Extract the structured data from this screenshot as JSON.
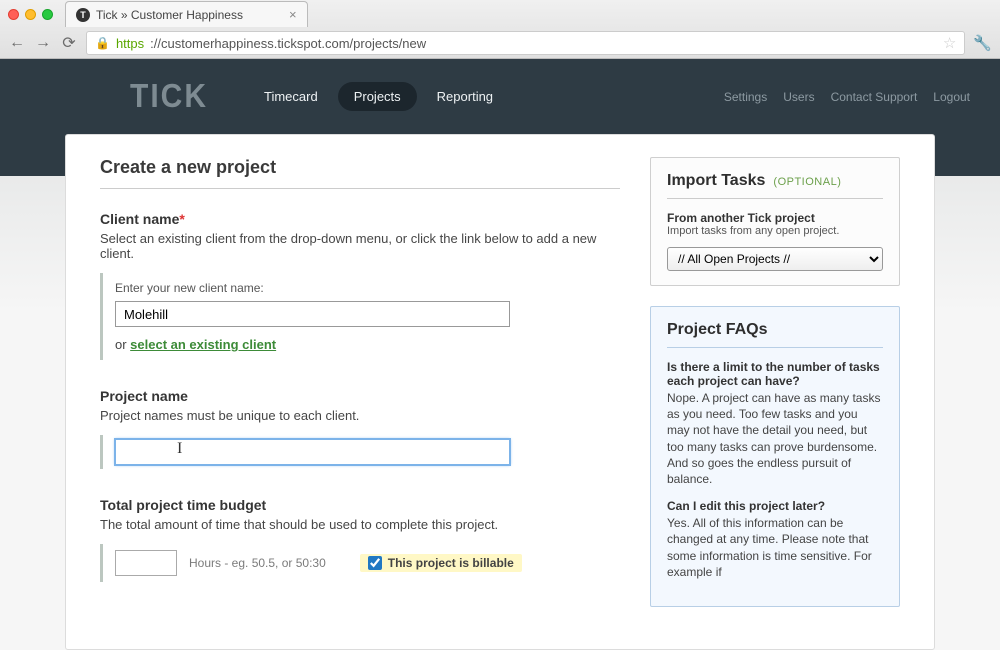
{
  "browser": {
    "tab_title": "Tick » Customer Happiness",
    "url_proto": "https",
    "url_rest": "://customerhappiness.tickspot.com/projects/new"
  },
  "header": {
    "logo": "TICK",
    "nav": {
      "timecard": "Timecard",
      "projects": "Projects",
      "reporting": "Reporting"
    },
    "right": {
      "settings": "Settings",
      "users": "Users",
      "contact": "Contact Support",
      "logout": "Logout"
    }
  },
  "page": {
    "title": "Create a new project",
    "client": {
      "label": "Client name",
      "helper": "Select an existing client from the drop-down menu, or click the link below to add a new client.",
      "hint": "Enter your new client name:",
      "value": "Molehill",
      "or": "or ",
      "select_link": "select an existing client"
    },
    "project": {
      "label": "Project name",
      "helper": "Project names must be unique to each client.",
      "value": ""
    },
    "budget": {
      "label": "Total project time budget",
      "helper": "The total amount of time that should be used to complete this project.",
      "value": "",
      "hint": "Hours - eg. 50.5, or 50:30",
      "billable_label": "This project is billable"
    }
  },
  "sidebar": {
    "import": {
      "title": "Import Tasks",
      "optional": "(OPTIONAL)",
      "sub_h": "From another Tick project",
      "sub_p": "Import tasks from any open project.",
      "select_value": "// All Open Projects //"
    },
    "faq": {
      "title": "Project FAQs",
      "q1": "Is there a limit to the number of tasks each project can have?",
      "a1": "Nope. A project can have as many tasks as you need. Too few tasks and you may not have the detail you need, but too many tasks can prove burdensome. And so goes the endless pursuit of balance.",
      "q2": "Can I edit this project later?",
      "a2": "Yes. All of this information can be changed at any time. Please note that some information is time sensitive. For example if"
    }
  }
}
